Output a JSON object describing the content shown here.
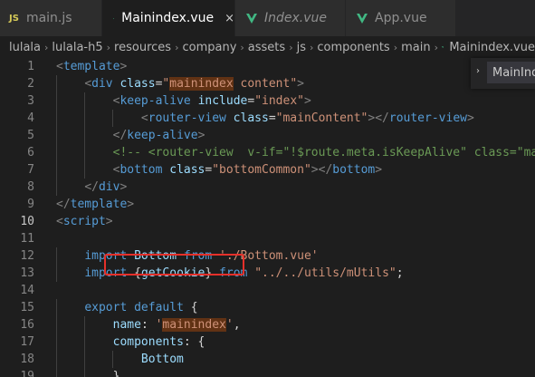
{
  "tabs": [
    {
      "label": "main.js",
      "icon": "js-file-icon",
      "active": false,
      "italic": false
    },
    {
      "label": "Mainindex.vue",
      "icon": "vue-file-icon",
      "active": true,
      "italic": false,
      "close": "×"
    },
    {
      "label": "Index.vue",
      "icon": "vue-file-icon",
      "active": false,
      "italic": true
    },
    {
      "label": "App.vue",
      "icon": "vue-file-icon",
      "active": false,
      "italic": false
    }
  ],
  "tab_js_badge": "JS",
  "breadcrumb": [
    "lulala",
    "lulala-h5",
    "resources",
    "company",
    "assets",
    "js",
    "components",
    "main",
    "Mainindex.vue"
  ],
  "breadcrumb_separator": "›",
  "outline": {
    "arrow": "›",
    "label": "MainInd"
  },
  "current_line": 10,
  "colors": {
    "editor_bg": "#1e1e1e",
    "tag": "#569cd6",
    "attribute": "#9cdcfe",
    "string": "#ce9178",
    "comment": "#6a9955",
    "vue_green": "#41b883",
    "red_box": "#e5302a"
  },
  "lines": [
    {
      "n": "1",
      "tokens": [
        {
          "c": "p",
          "t": "<"
        },
        {
          "c": "t",
          "t": "template"
        },
        {
          "c": "p",
          "t": ">"
        }
      ]
    },
    {
      "n": "2",
      "tokens": [
        {
          "c": "d",
          "t": "    "
        },
        {
          "c": "p",
          "t": "<"
        },
        {
          "c": "t",
          "t": "div"
        },
        {
          "c": "d",
          "t": " "
        },
        {
          "c": "a",
          "t": "class"
        },
        {
          "c": "d",
          "t": "="
        },
        {
          "c": "s",
          "t": "\""
        },
        {
          "c": "s hl",
          "t": "mainindex"
        },
        {
          "c": "s",
          "t": " content\""
        },
        {
          "c": "p",
          "t": ">"
        }
      ]
    },
    {
      "n": "3",
      "tokens": [
        {
          "c": "d",
          "t": "        "
        },
        {
          "c": "p",
          "t": "<"
        },
        {
          "c": "t",
          "t": "keep-alive"
        },
        {
          "c": "d",
          "t": " "
        },
        {
          "c": "a",
          "t": "include"
        },
        {
          "c": "d",
          "t": "="
        },
        {
          "c": "s",
          "t": "\"index\""
        },
        {
          "c": "p",
          "t": ">"
        }
      ]
    },
    {
      "n": "4",
      "tokens": [
        {
          "c": "d",
          "t": "            "
        },
        {
          "c": "p",
          "t": "<"
        },
        {
          "c": "t",
          "t": "router-view"
        },
        {
          "c": "d",
          "t": " "
        },
        {
          "c": "a",
          "t": "class"
        },
        {
          "c": "d",
          "t": "="
        },
        {
          "c": "s",
          "t": "\"mainContent\""
        },
        {
          "c": "p",
          "t": "></"
        },
        {
          "c": "t",
          "t": "router-view"
        },
        {
          "c": "p",
          "t": ">"
        }
      ]
    },
    {
      "n": "5",
      "tokens": [
        {
          "c": "d",
          "t": "        "
        },
        {
          "c": "p",
          "t": "</"
        },
        {
          "c": "t",
          "t": "keep-alive"
        },
        {
          "c": "p",
          "t": ">"
        }
      ]
    },
    {
      "n": "6",
      "tokens": [
        {
          "c": "d",
          "t": "        "
        },
        {
          "c": "c",
          "t": "<!-- <router-view  v-if=\"!$route.meta.isKeepAlive\" class=\"mainContent\"></router-view> -->"
        }
      ]
    },
    {
      "n": "7",
      "tokens": [
        {
          "c": "d",
          "t": "        "
        },
        {
          "c": "p",
          "t": "<"
        },
        {
          "c": "t",
          "t": "bottom"
        },
        {
          "c": "d",
          "t": " "
        },
        {
          "c": "a",
          "t": "class"
        },
        {
          "c": "d",
          "t": "="
        },
        {
          "c": "s",
          "t": "\"bottomCommon\""
        },
        {
          "c": "p",
          "t": "></"
        },
        {
          "c": "t",
          "t": "bottom"
        },
        {
          "c": "p",
          "t": ">"
        }
      ]
    },
    {
      "n": "8",
      "tokens": [
        {
          "c": "d",
          "t": "    "
        },
        {
          "c": "p",
          "t": "</"
        },
        {
          "c": "t",
          "t": "div"
        },
        {
          "c": "p",
          "t": ">"
        }
      ]
    },
    {
      "n": "9",
      "tokens": [
        {
          "c": "p",
          "t": "</"
        },
        {
          "c": "t",
          "t": "template"
        },
        {
          "c": "p",
          "t": ">"
        }
      ]
    },
    {
      "n": "10",
      "tokens": [
        {
          "c": "p",
          "t": "<"
        },
        {
          "c": "t",
          "t": "script"
        },
        {
          "c": "p",
          "t": ">"
        }
      ]
    },
    {
      "n": "11",
      "tokens": []
    },
    {
      "n": "12",
      "tokens": [
        {
          "c": "d",
          "t": "    "
        },
        {
          "c": "k",
          "t": "import"
        },
        {
          "c": "d",
          "t": " "
        },
        {
          "c": "a",
          "t": "Bottom"
        },
        {
          "c": "d",
          "t": " "
        },
        {
          "c": "k",
          "t": "from"
        },
        {
          "c": "d",
          "t": " "
        },
        {
          "c": "s",
          "t": "'./Bottom.vue'"
        }
      ]
    },
    {
      "n": "13",
      "tokens": [
        {
          "c": "d",
          "t": "    "
        },
        {
          "c": "k",
          "t": "import"
        },
        {
          "c": "d",
          "t": " {"
        },
        {
          "c": "a",
          "t": "getCookie"
        },
        {
          "c": "d",
          "t": "} "
        },
        {
          "c": "k",
          "t": "from"
        },
        {
          "c": "d",
          "t": " "
        },
        {
          "c": "s",
          "t": "\"../../utils/mUtils\""
        },
        {
          "c": "d",
          "t": ";"
        }
      ]
    },
    {
      "n": "14",
      "tokens": []
    },
    {
      "n": "15",
      "tokens": [
        {
          "c": "d",
          "t": "    "
        },
        {
          "c": "k",
          "t": "export"
        },
        {
          "c": "d",
          "t": " "
        },
        {
          "c": "k",
          "t": "default"
        },
        {
          "c": "d",
          "t": " {"
        }
      ]
    },
    {
      "n": "16",
      "tokens": [
        {
          "c": "d",
          "t": "        "
        },
        {
          "c": "a",
          "t": "name"
        },
        {
          "c": "d",
          "t": ": "
        },
        {
          "c": "s",
          "t": "'"
        },
        {
          "c": "s hl",
          "t": "mainindex"
        },
        {
          "c": "s",
          "t": "'"
        },
        {
          "c": "d",
          "t": ","
        }
      ]
    },
    {
      "n": "17",
      "tokens": [
        {
          "c": "d",
          "t": "        "
        },
        {
          "c": "a",
          "t": "components"
        },
        {
          "c": "d",
          "t": ": {"
        }
      ]
    },
    {
      "n": "18",
      "tokens": [
        {
          "c": "d",
          "t": "            "
        },
        {
          "c": "a",
          "t": "Bottom"
        }
      ]
    },
    {
      "n": "19",
      "tokens": [
        {
          "c": "d",
          "t": "        "
        },
        {
          "c": "d",
          "t": "},"
        }
      ]
    }
  ]
}
